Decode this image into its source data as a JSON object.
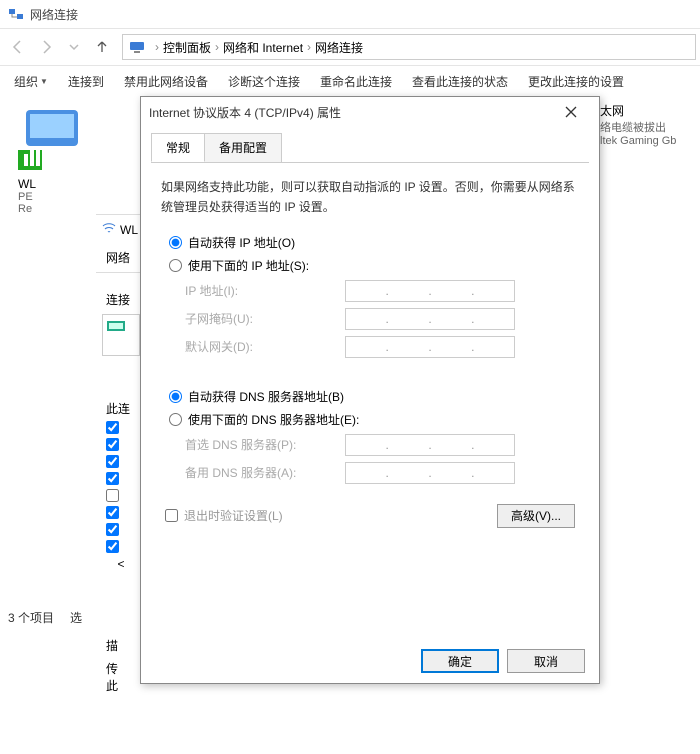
{
  "window": {
    "title": "网络连接"
  },
  "breadcrumb": {
    "root_icon": "computer-icon",
    "p1": "控制面板",
    "p2": "网络和 Internet",
    "p3": "网络连接",
    "sep": "›"
  },
  "toolbar": {
    "organize": "组织",
    "connect_to": "连接到",
    "disable_device": "禁用此网络设备",
    "diagnose": "诊断这个连接",
    "rename": "重命名此连接",
    "view_status": "查看此连接的状态",
    "change_settings": "更改此连接的设置"
  },
  "adapters": {
    "a1": {
      "name": "WL",
      "line2": "PE",
      "line3": "Re"
    },
    "a2": {
      "name": "太网",
      "line2": "络电缆被拔出",
      "line3": "ltek Gaming Gb"
    }
  },
  "sub": {
    "tab": "网络",
    "connect_using": "连接",
    "this_conn": "此连",
    "desc_label": "描",
    "trans_label": "传",
    "pass_label": "此",
    "sel_label": "选"
  },
  "statusbar": {
    "items_count": "3 个项目",
    "selected": "选"
  },
  "dialog": {
    "title": "Internet 协议版本 4 (TCP/IPv4) 属性",
    "tabs": {
      "general": "常规",
      "alternate": "备用配置"
    },
    "description": "如果网络支持此功能，则可以获取自动指派的 IP 设置。否则，你需要从网络系统管理员处获得适当的 IP 设置。",
    "ip": {
      "auto": "自动获得 IP 地址(O)",
      "manual": "使用下面的 IP 地址(S):",
      "addr": "IP 地址(I):",
      "mask": "子网掩码(U):",
      "gateway": "默认网关(D):"
    },
    "dns": {
      "auto": "自动获得 DNS 服务器地址(B)",
      "manual": "使用下面的 DNS 服务器地址(E):",
      "preferred": "首选 DNS 服务器(P):",
      "alternate": "备用 DNS 服务器(A):"
    },
    "validate_on_exit": "退出时验证设置(L)",
    "advanced": "高级(V)...",
    "ok": "确定",
    "cancel": "取消"
  },
  "sub_icon_label": "WL",
  "watermark": ""
}
